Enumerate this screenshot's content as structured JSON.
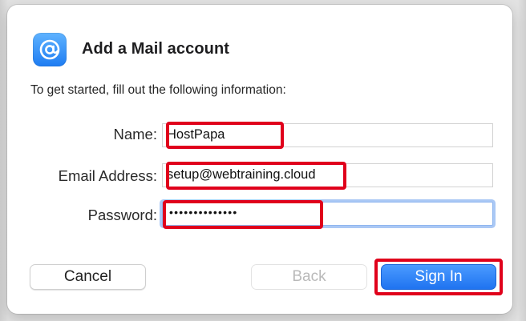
{
  "dialog": {
    "title": "Add a Mail account",
    "subtitle": "To get started, fill out the following information:",
    "icon": "mail-at-icon",
    "accent_color": "#1f73f0",
    "highlight_color": "#e0001b"
  },
  "form": {
    "name_label": "Name:",
    "name_value": "HostPapa",
    "email_label": "Email Address:",
    "email_value": "setup@webtraining.cloud",
    "password_label": "Password:",
    "password_value": "••••••••••••••"
  },
  "buttons": {
    "cancel_label": "Cancel",
    "back_label": "Back",
    "signin_label": "Sign In"
  }
}
